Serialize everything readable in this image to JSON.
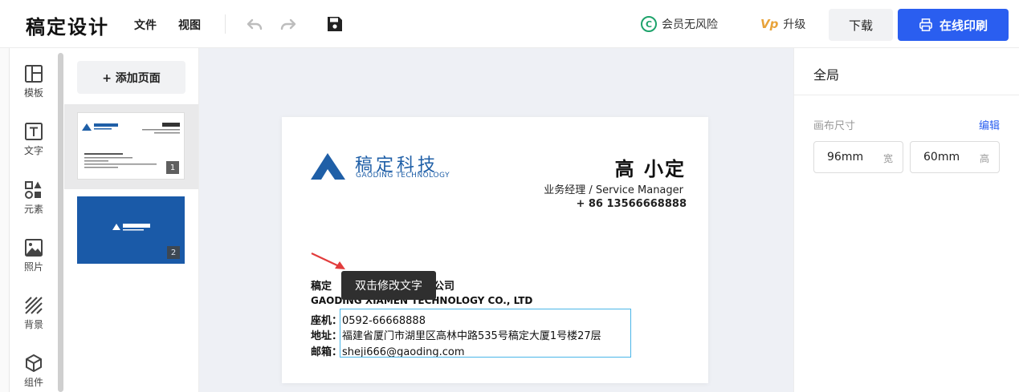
{
  "header": {
    "logo": "稿定设计",
    "menu": {
      "file": "文件",
      "view": "视图"
    },
    "vip_safe": "会员无风险",
    "vip_safe_icon": "C",
    "upgrade": "升级",
    "upgrade_badge": "Vp",
    "download": "下载",
    "print": "在线印刷"
  },
  "sidebar": {
    "items": [
      {
        "label": "模板",
        "icon": "template-icon"
      },
      {
        "label": "文字",
        "icon": "text-icon"
      },
      {
        "label": "元素",
        "icon": "elements-icon"
      },
      {
        "label": "照片",
        "icon": "photo-icon"
      },
      {
        "label": "背景",
        "icon": "background-icon"
      },
      {
        "label": "组件",
        "icon": "component-icon"
      }
    ]
  },
  "pages": {
    "add_page": "+ 添加页面",
    "thumbs": [
      {
        "num": "1"
      },
      {
        "num": "2"
      }
    ]
  },
  "card": {
    "brand_cn": "稿定科技",
    "brand_en": "GAODING TECHNOLOGY",
    "name": "高 小定",
    "title": "业务经理 / Service Manager",
    "phone": "+ 86 13566668888",
    "company_start": "稿定",
    "company_end": "公司",
    "company_en": "GAODING XIAMEN TECHNOLOGY CO., LTD",
    "rows": {
      "tel_label": "座机：",
      "tel": "0592-66668888",
      "addr_label": "地址：",
      "addr": "福建省厦门市湖里区高林中路535号稿定大厦1号楼27层",
      "mail_label": "邮箱：",
      "mail": "sheji666@gaoding.com"
    },
    "tooltip": "双击修改文字"
  },
  "right_panel": {
    "title": "全局",
    "canvas_size_label": "画布尺寸",
    "edit": "编辑",
    "width": {
      "value": "96mm",
      "unit": "宽"
    },
    "height": {
      "value": "60mm",
      "unit": "高"
    }
  },
  "colors": {
    "brand_blue": "#1f5fa7",
    "primary": "#2a5ef0",
    "selection": "#4bb6e8",
    "tooltip_bg": "#2f2f2f",
    "vip_green": "#1ea36b"
  }
}
